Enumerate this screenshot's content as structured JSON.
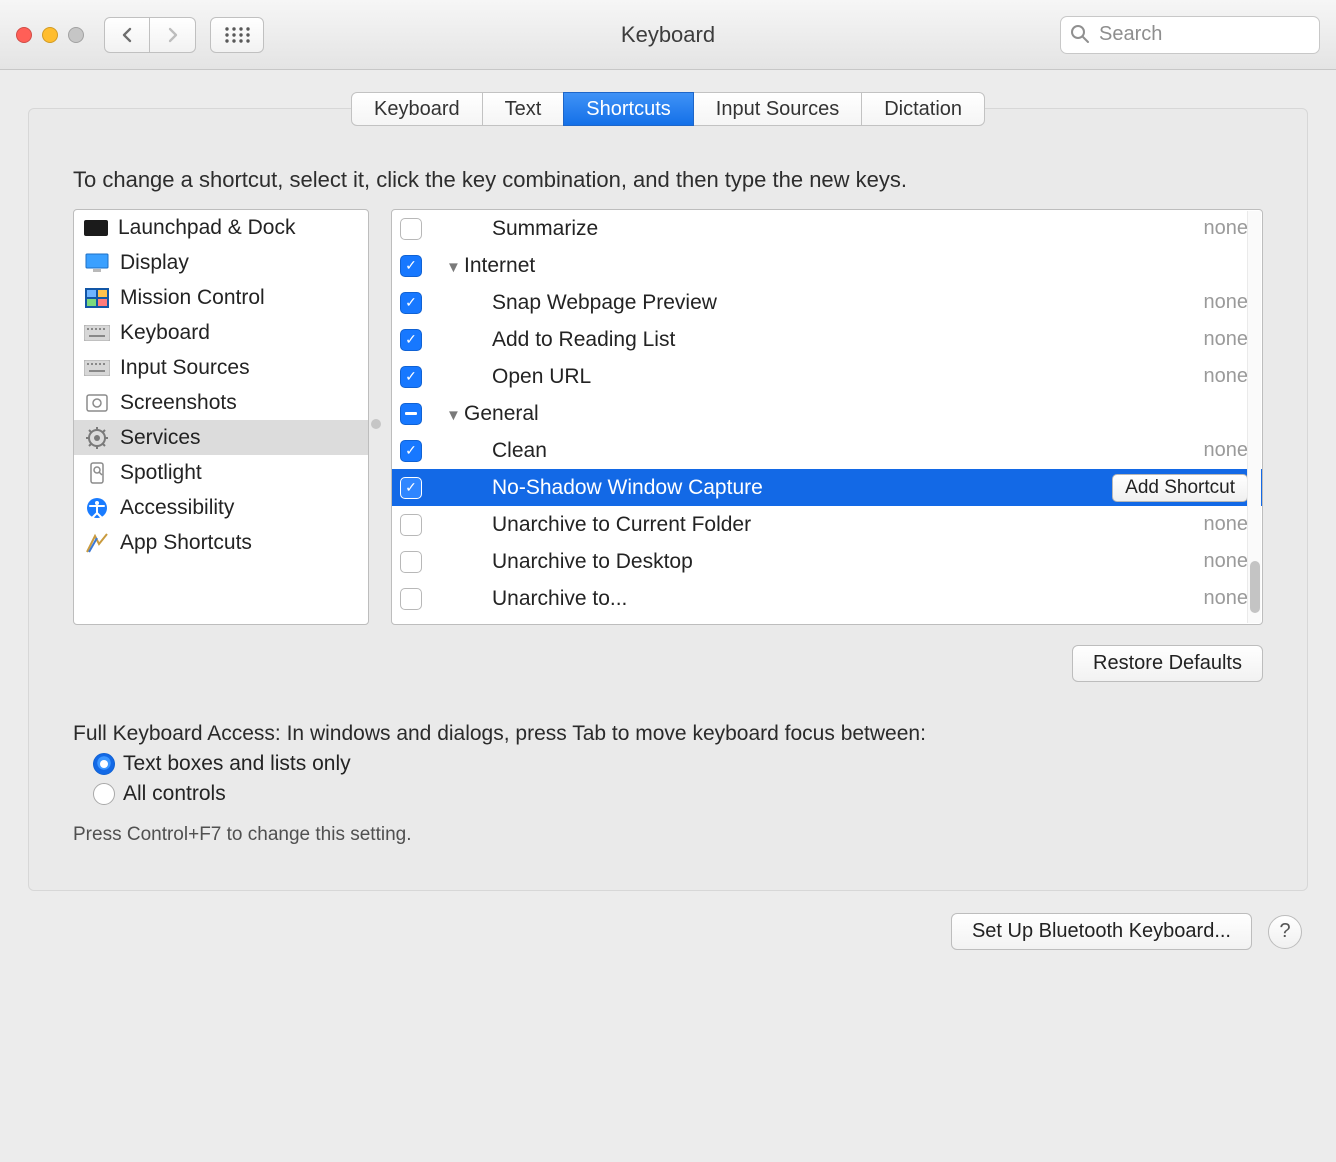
{
  "window": {
    "title": "Keyboard"
  },
  "search": {
    "placeholder": "Search",
    "value": ""
  },
  "tabs": [
    {
      "label": "Keyboard",
      "active": false
    },
    {
      "label": "Text",
      "active": false
    },
    {
      "label": "Shortcuts",
      "active": true
    },
    {
      "label": "Input Sources",
      "active": false
    },
    {
      "label": "Dictation",
      "active": false
    }
  ],
  "instruction": "To change a shortcut, select it, click the key combination, and then type the new keys.",
  "sidebar": {
    "items": [
      {
        "id": "launchpad",
        "label": "Launchpad & Dock",
        "icon": "launchpad-icon"
      },
      {
        "id": "display",
        "label": "Display",
        "icon": "display-icon"
      },
      {
        "id": "mission",
        "label": "Mission Control",
        "icon": "mission-icon"
      },
      {
        "id": "keyboard",
        "label": "Keyboard",
        "icon": "keyboard-icon"
      },
      {
        "id": "inputsources",
        "label": "Input Sources",
        "icon": "keyboard-icon"
      },
      {
        "id": "screenshots",
        "label": "Screenshots",
        "icon": "screenshots-icon"
      },
      {
        "id": "services",
        "label": "Services",
        "icon": "services-icon",
        "active": true
      },
      {
        "id": "spotlight",
        "label": "Spotlight",
        "icon": "spotlight-icon"
      },
      {
        "id": "accessibility",
        "label": "Accessibility",
        "icon": "accessibility-icon"
      },
      {
        "id": "appshortcuts",
        "label": "App Shortcuts",
        "icon": "appshortcuts-icon"
      }
    ]
  },
  "details": {
    "rows": [
      {
        "kind": "item",
        "level": 2,
        "label": "Summarize",
        "check": "off",
        "shortcut": "none"
      },
      {
        "kind": "group",
        "level": 1,
        "label": "Internet",
        "check": "on",
        "expanded": true
      },
      {
        "kind": "item",
        "level": 2,
        "label": "Snap Webpage Preview",
        "check": "on",
        "shortcut": "none"
      },
      {
        "kind": "item",
        "level": 2,
        "label": "Add to Reading List",
        "check": "on",
        "shortcut": "none"
      },
      {
        "kind": "item",
        "level": 2,
        "label": "Open URL",
        "check": "on",
        "shortcut": "none"
      },
      {
        "kind": "group",
        "level": 1,
        "label": "General",
        "check": "mixed",
        "expanded": true
      },
      {
        "kind": "item",
        "level": 2,
        "label": "Clean",
        "check": "on",
        "shortcut": "none"
      },
      {
        "kind": "item",
        "level": 2,
        "label": "No-Shadow Window Capture",
        "check": "on",
        "shortcut": "",
        "selected": true,
        "add_shortcut": true
      },
      {
        "kind": "item",
        "level": 2,
        "label": "Unarchive to Current Folder",
        "check": "off",
        "shortcut": "none"
      },
      {
        "kind": "item",
        "level": 2,
        "label": "Unarchive to Desktop",
        "check": "off",
        "shortcut": "none"
      },
      {
        "kind": "item",
        "level": 2,
        "label": "Unarchive to...",
        "check": "off",
        "shortcut": "none"
      }
    ]
  },
  "buttons": {
    "restore_defaults": "Restore Defaults",
    "add_shortcut": "Add Shortcut",
    "bluetooth_keyboard": "Set Up Bluetooth Keyboard...",
    "help": "?"
  },
  "full_keyboard_access": {
    "label": "Full Keyboard Access: In windows and dialogs, press Tab to move keyboard focus between:",
    "options": [
      {
        "label": "Text boxes and lists only",
        "selected": true
      },
      {
        "label": "All controls",
        "selected": false
      }
    ],
    "hint": "Press Control+F7 to change this setting."
  }
}
